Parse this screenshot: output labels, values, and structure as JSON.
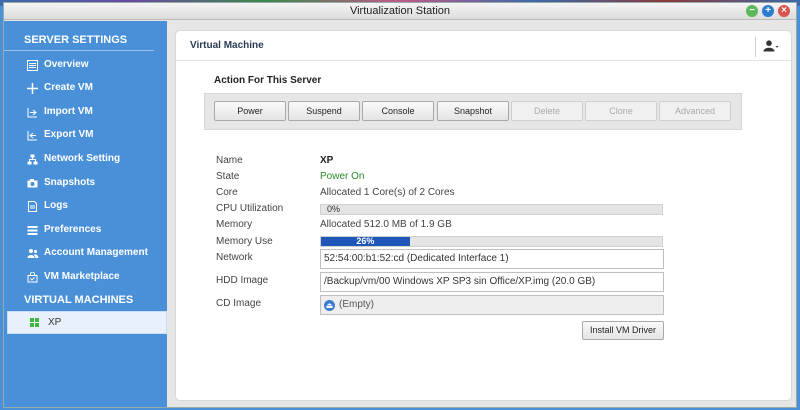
{
  "window": {
    "title": "Virtualization Station"
  },
  "sidebar": {
    "server_settings_label": "SERVER SETTINGS",
    "items": [
      {
        "label": "Overview",
        "icon": "overview-icon"
      },
      {
        "label": "Create VM",
        "icon": "plus-icon"
      },
      {
        "label": "Import VM",
        "icon": "import-icon"
      },
      {
        "label": "Export VM",
        "icon": "export-icon"
      },
      {
        "label": "Network Setting",
        "icon": "network-icon"
      },
      {
        "label": "Snapshots",
        "icon": "snapshot-icon"
      },
      {
        "label": "Logs",
        "icon": "logs-icon"
      },
      {
        "label": "Preferences",
        "icon": "preferences-icon"
      },
      {
        "label": "Account Management",
        "icon": "account-icon"
      },
      {
        "label": "VM Marketplace",
        "icon": "marketplace-icon"
      }
    ],
    "virtual_machines_label": "VIRTUAL MACHINES",
    "vm_item": "XP"
  },
  "content": {
    "title": "Virtual Machine",
    "action_title": "Action For This Server",
    "actions": [
      {
        "label": "Power",
        "enabled": true
      },
      {
        "label": "Suspend",
        "enabled": true
      },
      {
        "label": "Console",
        "enabled": true
      },
      {
        "label": "Snapshot",
        "enabled": true
      },
      {
        "label": "Delete",
        "enabled": false
      },
      {
        "label": "Clone",
        "enabled": false
      },
      {
        "label": "Advanced",
        "enabled": false
      }
    ],
    "info": {
      "name_label": "Name",
      "name_value": "XP",
      "state_label": "State",
      "state_value": "Power On",
      "core_label": "Core",
      "core_value": "Allocated 1 Core(s) of 2 Cores",
      "cpu_label": "CPU Utilization",
      "cpu_value": "0%",
      "cpu_percent": 0,
      "memory_label": "Memory",
      "memory_value": "Allocated 512.0 MB of 1.9 GB",
      "memory_use_label": "Memory Use",
      "memory_use_value": "26%",
      "memory_use_percent": 26,
      "network_label": "Network",
      "network_value": "52:54:00:b1:52:cd (Dedicated Interface 1)",
      "hdd_label": "HDD Image",
      "hdd_value": "/Backup/vm/00 Windows XP SP3 sin Office/XP.img (20.0 GB)",
      "cd_label": "CD Image",
      "cd_value": "(Empty)"
    },
    "install_button": "Install VM Driver"
  },
  "colors": {
    "sidebar_bg": "#4a90d9",
    "progress_fill": "#1f57b8",
    "state_green": "#2a8a2a"
  }
}
